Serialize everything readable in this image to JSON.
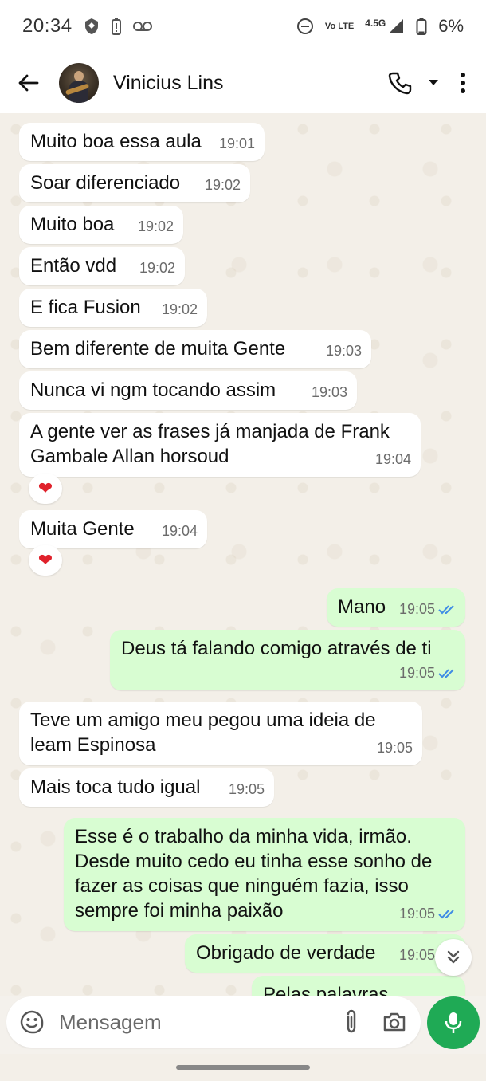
{
  "status": {
    "time": "20:34",
    "network": "4.5G",
    "volte": "Vo LTE",
    "battery": "6%"
  },
  "header": {
    "contact_name": "Vinicius Lins",
    "icons": [
      "back-arrow-icon",
      "phone-icon",
      "dropdown-icon",
      "more-vert-icon"
    ]
  },
  "messages": [
    {
      "dir": "in",
      "text": "Muito boa essa aula",
      "time": "19:01"
    },
    {
      "dir": "in",
      "text": "Soar diferenciado",
      "time": "19:02"
    },
    {
      "dir": "in",
      "text": "Muito boa",
      "time": "19:02"
    },
    {
      "dir": "in",
      "text": "Então vdd",
      "time": "19:02"
    },
    {
      "dir": "in",
      "text": "E fica Fusion",
      "time": "19:02"
    },
    {
      "dir": "in",
      "text": "Bem diferente de muita Gente",
      "time": "19:03"
    },
    {
      "dir": "in",
      "text": "Nunca vi ngm tocando assim",
      "time": "19:03"
    },
    {
      "dir": "in",
      "text": "A gente ver as frases já manjada de Frank Gambale Allan horsoud",
      "time": "19:04",
      "reaction": "❤"
    },
    {
      "dir": "in",
      "text": "Muita Gente",
      "time": "19:04",
      "reaction": "❤"
    },
    {
      "dir": "out",
      "text": "Mano",
      "time": "19:05",
      "status": "read"
    },
    {
      "dir": "out",
      "text": "Deus tá falando comigo através de ti",
      "time": "19:05",
      "status": "read"
    },
    {
      "dir": "in",
      "text": "Teve um amigo meu pegou uma ideia de leam Espinosa",
      "time": "19:05"
    },
    {
      "dir": "in",
      "text": "Mais toca tudo igual",
      "time": "19:05"
    },
    {
      "dir": "out",
      "text": "Esse é o trabalho da minha vida, irmão. Desde muito cedo eu tinha esse sonho de fazer as coisas que ninguém fazia, isso sempre foi minha paixão",
      "time": "19:05",
      "status": "read"
    },
    {
      "dir": "out",
      "text": "Obrigado de verdade",
      "time": "19:05",
      "status": "read"
    },
    {
      "dir": "out",
      "text": "Pelas palavras",
      "time": ""
    }
  ],
  "composer": {
    "placeholder": "Mensagem",
    "value": "",
    "icons": [
      "emoji-icon",
      "attach-icon",
      "camera-icon",
      "mic-icon"
    ]
  },
  "colors": {
    "outgoing_bubble": "#d8fdd2",
    "incoming_bubble": "#ffffff",
    "accent_green": "#1faa55",
    "read_tick": "#3f8ce5",
    "chat_background": "#f3efe8"
  }
}
